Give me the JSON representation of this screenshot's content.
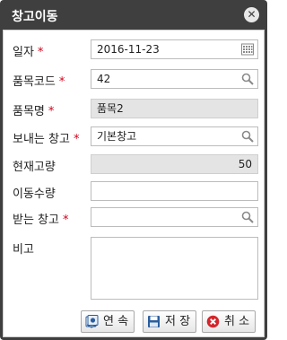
{
  "dialog": {
    "title": "창고이동",
    "close_glyph": "✕"
  },
  "form": {
    "date": {
      "label": "일자",
      "required_mark": "*",
      "value": "2016-11-23",
      "icon": "calendar-icon"
    },
    "item_code": {
      "label": "품목코드",
      "required_mark": "*",
      "value": "42",
      "icon": "search-icon"
    },
    "item_name": {
      "label": "품목명",
      "required_mark": "*",
      "value": "품목2"
    },
    "from_warehouse": {
      "label": "보내는 창고",
      "required_mark": "*",
      "value": "기본창고",
      "icon": "search-icon"
    },
    "current_stock": {
      "label": "현재고량",
      "value": "50"
    },
    "move_qty": {
      "label": "이동수량",
      "value": ""
    },
    "to_warehouse": {
      "label": "받는 창고",
      "required_mark": "*",
      "value": "",
      "icon": "search-icon"
    },
    "remark": {
      "label": "비고",
      "value": ""
    }
  },
  "buttons": {
    "continue_label": "연 속",
    "save_label": "저 장",
    "cancel_label": "취 소"
  },
  "colors": {
    "titlebar": "#3f3f3f",
    "required": "#d0021b",
    "readonly_bg": "#e4e4e4"
  }
}
